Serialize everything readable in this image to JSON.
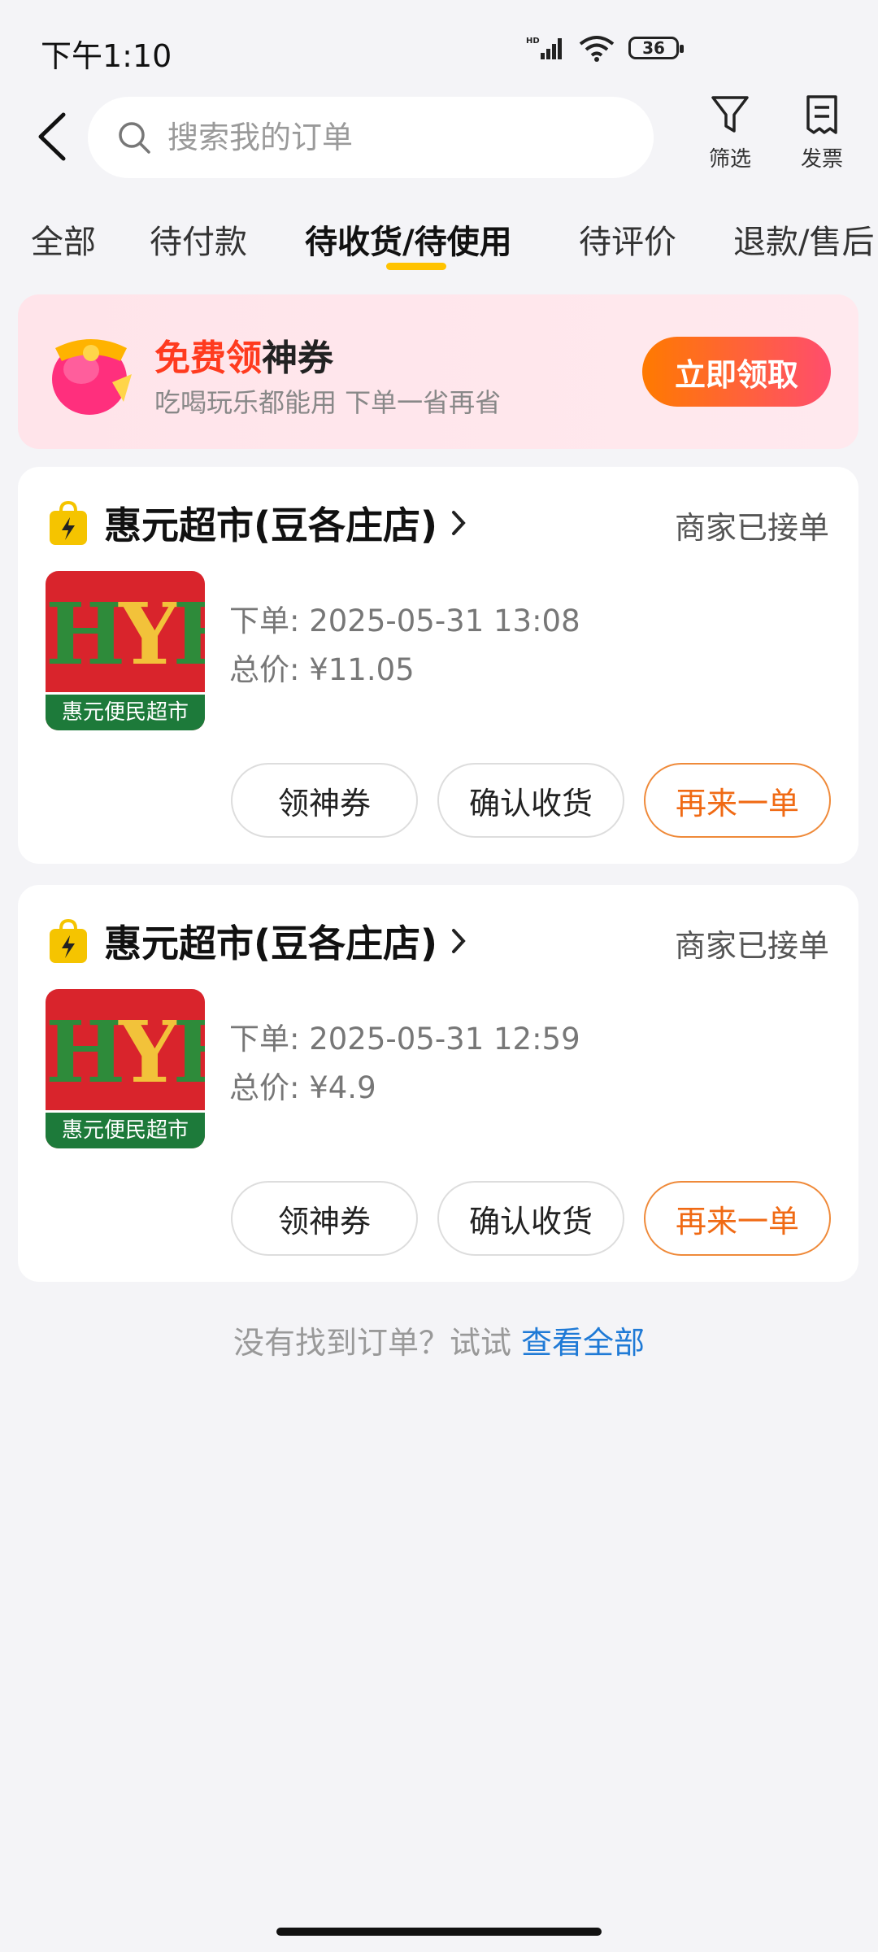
{
  "status_bar": {
    "time": "下午1:10",
    "battery": "36"
  },
  "search": {
    "placeholder": "搜索我的订单"
  },
  "toolbar": {
    "filter_label": "筛选",
    "invoice_label": "发票"
  },
  "tabs": [
    {
      "label": "全部"
    },
    {
      "label": "待付款"
    },
    {
      "label": "待收货/待使用",
      "active": true
    },
    {
      "label": "待评价"
    },
    {
      "label": "退款/售后"
    }
  ],
  "promo": {
    "title_highlight": "免费领",
    "title_rest": "神券",
    "subtitle": "吃喝玩乐都能用 下单一省再省",
    "button": "立即领取"
  },
  "orders": [
    {
      "store": "惠元超市(豆各庄店)",
      "status": "商家已接单",
      "logo_band": "惠元便民超市",
      "order_time": "下单: 2025-05-31 13:08",
      "total": "总价: ¥11.05",
      "actions": [
        "领神券",
        "确认收货",
        "再来一单"
      ]
    },
    {
      "store": "惠元超市(豆各庄店)",
      "status": "商家已接单",
      "logo_band": "惠元便民超市",
      "order_time": "下单: 2025-05-31 12:59",
      "total": "总价: ¥4.9",
      "actions": [
        "领神券",
        "确认收货",
        "再来一单"
      ]
    }
  ],
  "hint": {
    "text": "没有找到订单？试试 ",
    "link": "查看全部"
  },
  "colors": {
    "accent": "#ffc300",
    "price_red": "#ff3b1f",
    "link": "#1f7ad6",
    "reorder": "#f06a14"
  }
}
